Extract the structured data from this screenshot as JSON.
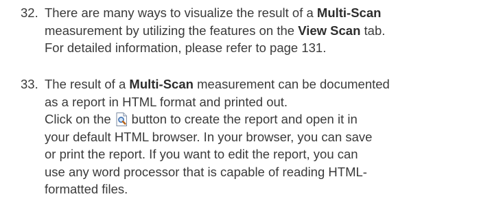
{
  "steps": [
    {
      "number": "32.",
      "line1": {
        "pre": "There are many ways to visualize the result of a ",
        "bold": "Multi-Scan"
      },
      "line2": {
        "pre": "measurement by utilizing the features on the ",
        "bold": "View Scan",
        "post": " tab."
      },
      "line3": "For detailed information, please refer to page 131."
    },
    {
      "number": "33.",
      "line1": {
        "pre": "The result of a ",
        "bold": "Multi-Scan",
        "post": " measurement can be documented"
      },
      "line2": "as a report in HTML format and printed out.",
      "line3": {
        "pre": "Click on the",
        "post": "button to create the report and open it in"
      },
      "line4": "your default HTML browser. In your browser, you can save",
      "line5": "or print the report. If you want to edit the report, you can",
      "line6": "use any word processor that is capable of reading HTML-",
      "line7": "formatted files.",
      "icon": "report-preview-icon"
    }
  ]
}
